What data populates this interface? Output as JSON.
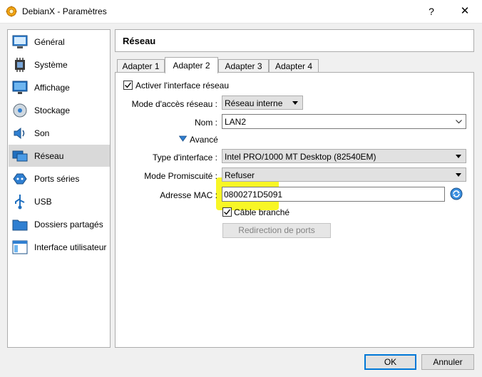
{
  "window": {
    "title": "DebianX - Paramètres",
    "help_glyph": "?",
    "close_glyph": "✕"
  },
  "sidebar": {
    "items": [
      {
        "label": "Général",
        "icon": "general-icon"
      },
      {
        "label": "Système",
        "icon": "system-icon"
      },
      {
        "label": "Affichage",
        "icon": "display-icon"
      },
      {
        "label": "Stockage",
        "icon": "storage-icon"
      },
      {
        "label": "Son",
        "icon": "audio-icon"
      },
      {
        "label": "Réseau",
        "icon": "network-icon",
        "selected": true
      },
      {
        "label": "Ports séries",
        "icon": "serial-ports-icon"
      },
      {
        "label": "USB",
        "icon": "usb-icon"
      },
      {
        "label": "Dossiers partagés",
        "icon": "shared-folders-icon"
      },
      {
        "label": "Interface utilisateur",
        "icon": "user-interface-icon"
      }
    ]
  },
  "header": {
    "title": "Réseau"
  },
  "tabs": [
    {
      "label": "Adapter 1"
    },
    {
      "label": "Adapter 2",
      "active": true
    },
    {
      "label": "Adapter 3"
    },
    {
      "label": "Adapter 4"
    }
  ],
  "network": {
    "enable_label": "Activer l'interface réseau",
    "enable_checked": true,
    "attach_label": "Mode d'accès réseau :",
    "attach_value": "Réseau interne",
    "name_label": "Nom :",
    "name_value": "LAN2",
    "advanced_label": "Avancé",
    "adapter_type_label": "Type d'interface :",
    "adapter_type_value": "Intel PRO/1000 MT Desktop (82540EM)",
    "promisc_label": "Mode Promiscuité :",
    "promisc_value": "Refuser",
    "mac_label": "Adresse MAC :",
    "mac_value": "0800271D5091",
    "cable_label": "Câble branché",
    "cable_checked": true,
    "port_forwarding_label": "Redirection de ports"
  },
  "footer": {
    "ok_label": "OK",
    "cancel_label": "Annuler"
  },
  "colors": {
    "highlight": "#f7f400",
    "accent": "#0078d7",
    "selected_item": "#d9d9d9"
  }
}
